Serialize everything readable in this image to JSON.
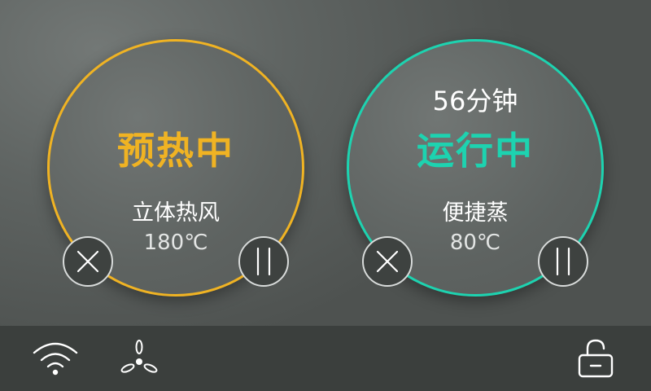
{
  "colors": {
    "preheat_accent": "#f0b323",
    "running_accent": "#1dd3b0",
    "bar_background": "#3b3f3d"
  },
  "left_panel": {
    "status": "预热中",
    "mode": "立体热风",
    "temperature": "180℃",
    "cancel_icon": "close-icon",
    "pause_icon": "pause-icon"
  },
  "right_panel": {
    "time_remaining": "56分钟",
    "status": "运行中",
    "mode": "便捷蒸",
    "temperature": "80℃",
    "cancel_icon": "close-icon",
    "pause_icon": "pause-icon"
  },
  "bottom_bar": {
    "icons": [
      "wifi-icon",
      "fan-icon",
      "unlocked-icon"
    ]
  }
}
